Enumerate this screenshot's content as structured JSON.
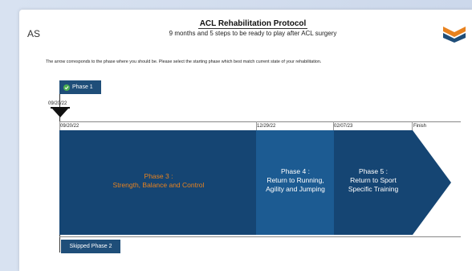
{
  "header": {
    "avatar_initials": "AS",
    "title": "ACL Rehabilitation Protocol",
    "subtitle": "9 months and 5 steps to be ready to play after ACL surgery"
  },
  "instructions": "The arrow corresponds to the phase where you should be. Please select the starting phase which best match current state of your rehabilitation.",
  "current_marker": {
    "phase_label": "Phase 1",
    "date": "09/20/22"
  },
  "timeline": {
    "dates": [
      "09/20/22",
      "12/29/22",
      "02/07/23",
      "Finish"
    ],
    "phases": [
      {
        "title": "Phase 3 :",
        "subtitle": "Strength, Balance and Control"
      },
      {
        "title": "Phase 4 :",
        "subtitle_lines": [
          "Return to Running,",
          "Agility and Jumping"
        ]
      },
      {
        "title": "Phase 5 :",
        "subtitle_lines": [
          "Return to Sport",
          "Specific Training"
        ]
      }
    ]
  },
  "skipped": {
    "label": "Skipped Phase 2"
  },
  "colors": {
    "phase3": "#154573",
    "phase4": "#1c5b92",
    "phase5": "#154573",
    "phase3_text": "#e8821e",
    "badge": "#1f4e79"
  }
}
